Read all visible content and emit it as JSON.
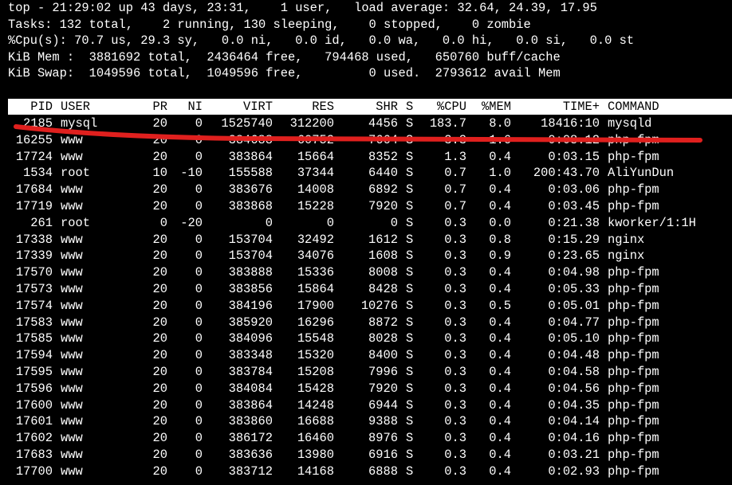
{
  "summary": {
    "lines": [
      "top - 21:29:02 up 43 days, 23:31,    1 user,   load average: 32.64, 24.39, 17.95",
      "Tasks: 132 total,    2 running, 130 sleeping,    0 stopped,    0 zombie",
      "%Cpu(s): 70.7 us, 29.3 sy,   0.0 ni,   0.0 id,   0.0 wa,   0.0 hi,   0.0 si,   0.0 st",
      "KiB Mem :  3881692 total,  2436464 free,   794468 used,   650760 buff/cache",
      "KiB Swap:  1049596 total,  1049596 free,         0 used.  2793612 avail Mem"
    ]
  },
  "process_table": {
    "columns": [
      "PID",
      "USER",
      "PR",
      "NI",
      "VIRT",
      "RES",
      "SHR",
      "S",
      "%CPU",
      "%MEM",
      "TIME+",
      "COMMAND"
    ],
    "rows": [
      [
        "2185",
        "mysql",
        "20",
        "0",
        "1525740",
        "312200",
        "4456",
        "S",
        "183.7",
        "8.0",
        "18416:10",
        "mysqld"
      ],
      [
        "16255",
        "www",
        "20",
        "0",
        "384688",
        "60752",
        "7664",
        "S",
        "3.3",
        "1.6",
        "0:08.12",
        "php-fpm"
      ],
      [
        "17724",
        "www",
        "20",
        "0",
        "383864",
        "15664",
        "8352",
        "S",
        "1.3",
        "0.4",
        "0:03.15",
        "php-fpm"
      ],
      [
        "1534",
        "root",
        "10",
        "-10",
        "155588",
        "37344",
        "6440",
        "S",
        "0.7",
        "1.0",
        "200:43.70",
        "AliYunDun"
      ],
      [
        "17684",
        "www",
        "20",
        "0",
        "383676",
        "14008",
        "6892",
        "S",
        "0.7",
        "0.4",
        "0:03.06",
        "php-fpm"
      ],
      [
        "17719",
        "www",
        "20",
        "0",
        "383868",
        "15228",
        "7920",
        "S",
        "0.7",
        "0.4",
        "0:03.45",
        "php-fpm"
      ],
      [
        "261",
        "root",
        "0",
        "-20",
        "0",
        "0",
        "0",
        "S",
        "0.3",
        "0.0",
        "0:21.38",
        "kworker/1:1H"
      ],
      [
        "17338",
        "www",
        "20",
        "0",
        "153704",
        "32492",
        "1612",
        "S",
        "0.3",
        "0.8",
        "0:15.29",
        "nginx"
      ],
      [
        "17339",
        "www",
        "20",
        "0",
        "153704",
        "34076",
        "1608",
        "S",
        "0.3",
        "0.9",
        "0:23.65",
        "nginx"
      ],
      [
        "17570",
        "www",
        "20",
        "0",
        "383888",
        "15336",
        "8008",
        "S",
        "0.3",
        "0.4",
        "0:04.98",
        "php-fpm"
      ],
      [
        "17573",
        "www",
        "20",
        "0",
        "383856",
        "15864",
        "8428",
        "S",
        "0.3",
        "0.4",
        "0:05.33",
        "php-fpm"
      ],
      [
        "17574",
        "www",
        "20",
        "0",
        "384196",
        "17900",
        "10276",
        "S",
        "0.3",
        "0.5",
        "0:05.01",
        "php-fpm"
      ],
      [
        "17583",
        "www",
        "20",
        "0",
        "385920",
        "16296",
        "8872",
        "S",
        "0.3",
        "0.4",
        "0:04.77",
        "php-fpm"
      ],
      [
        "17585",
        "www",
        "20",
        "0",
        "384096",
        "15548",
        "8028",
        "S",
        "0.3",
        "0.4",
        "0:05.10",
        "php-fpm"
      ],
      [
        "17594",
        "www",
        "20",
        "0",
        "383348",
        "15320",
        "8400",
        "S",
        "0.3",
        "0.4",
        "0:04.48",
        "php-fpm"
      ],
      [
        "17595",
        "www",
        "20",
        "0",
        "383784",
        "15208",
        "7996",
        "S",
        "0.3",
        "0.4",
        "0:04.58",
        "php-fpm"
      ],
      [
        "17596",
        "www",
        "20",
        "0",
        "384084",
        "15428",
        "7920",
        "S",
        "0.3",
        "0.4",
        "0:04.56",
        "php-fpm"
      ],
      [
        "17600",
        "www",
        "20",
        "0",
        "383864",
        "14248",
        "6944",
        "S",
        "0.3",
        "0.4",
        "0:04.35",
        "php-fpm"
      ],
      [
        "17601",
        "www",
        "20",
        "0",
        "383860",
        "16688",
        "9388",
        "S",
        "0.3",
        "0.4",
        "0:04.14",
        "php-fpm"
      ],
      [
        "17602",
        "www",
        "20",
        "0",
        "386172",
        "16460",
        "8976",
        "S",
        "0.3",
        "0.4",
        "0:04.16",
        "php-fpm"
      ],
      [
        "17683",
        "www",
        "20",
        "0",
        "383636",
        "13980",
        "6916",
        "S",
        "0.3",
        "0.4",
        "0:03.21",
        "php-fpm"
      ],
      [
        "17700",
        "www",
        "20",
        "0",
        "383712",
        "14168",
        "6888",
        "S",
        "0.3",
        "0.4",
        "0:02.93",
        "php-fpm"
      ]
    ]
  },
  "colors": {
    "background": "#000000",
    "text": "#ffffff",
    "header_background": "#ffffff",
    "header_text": "#000000",
    "annotation_stroke": "#e0201e"
  }
}
